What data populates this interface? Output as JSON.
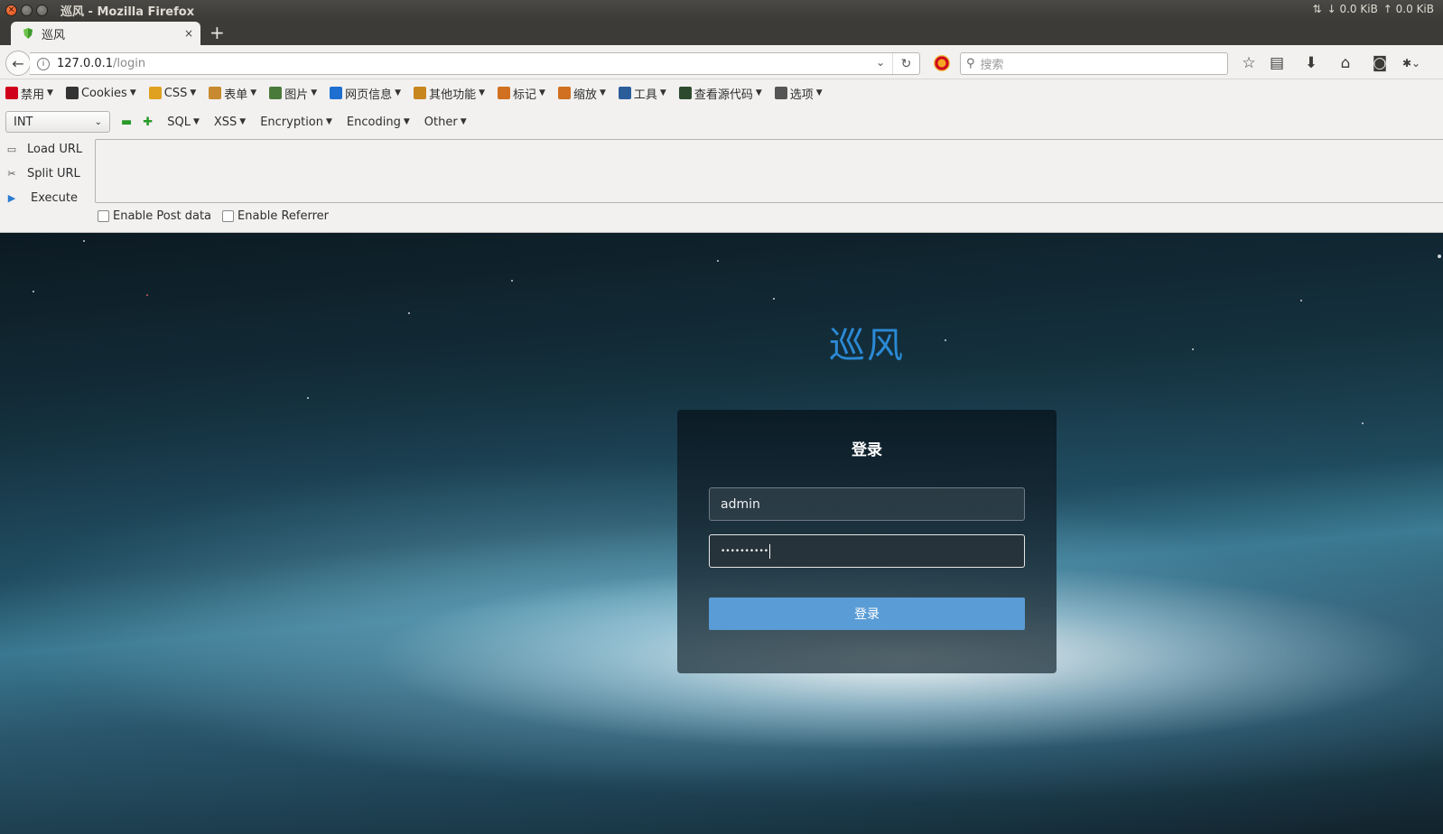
{
  "window": {
    "title": "巡风 - Mozilla Firefox",
    "net_down": "↓ 0.0 KiB",
    "net_up": "↑ 0.0 KiB"
  },
  "tab": {
    "title": "巡风",
    "close": "×",
    "new_tab": "+"
  },
  "navbar": {
    "url_host": "127.0.0.1",
    "url_path": "/login",
    "search_placeholder": "搜索"
  },
  "devbar": {
    "items": [
      {
        "label": "禁用",
        "icon": "disable-icon",
        "color": "#d0021b"
      },
      {
        "label": "Cookies",
        "icon": "cookie-icon",
        "color": "#333333"
      },
      {
        "label": "CSS",
        "icon": "css-icon",
        "color": "#e0a020"
      },
      {
        "label": "表单",
        "icon": "form-icon",
        "color": "#c88a30"
      },
      {
        "label": "图片",
        "icon": "image-icon",
        "color": "#4a7a3a"
      },
      {
        "label": "网页信息",
        "icon": "info-icon",
        "color": "#1f6fd0"
      },
      {
        "label": "其他功能",
        "icon": "misc-icon",
        "color": "#c8861e"
      },
      {
        "label": "标记",
        "icon": "outline-icon",
        "color": "#d07020"
      },
      {
        "label": "缩放",
        "icon": "resize-icon",
        "color": "#d07020"
      },
      {
        "label": "工具",
        "icon": "tools-icon",
        "color": "#2b5d9b"
      },
      {
        "label": "查看源代码",
        "icon": "source-icon",
        "color": "#2e4a2e"
      },
      {
        "label": "选项",
        "icon": "options-icon",
        "color": "#555555"
      }
    ]
  },
  "hackbar": {
    "select_value": "INT",
    "menus": [
      "SQL",
      "XSS",
      "Encoding"
    ],
    "menu_encryption": "Encryption",
    "menu_other": "Other",
    "load_url": "Load URL",
    "split_url": "Split URL",
    "execute": "Execute",
    "enable_post": "Enable Post data",
    "enable_referrer": "Enable Referrer"
  },
  "page": {
    "brand": "巡风",
    "login_title": "登录",
    "username_value": "admin",
    "password_masked": "••••••••••",
    "submit_label": "登录",
    "brand_color": "#2b89d4",
    "button_color": "#5a9cd6"
  }
}
